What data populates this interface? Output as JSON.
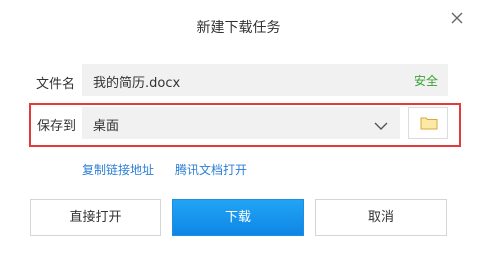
{
  "dialog": {
    "title": "新建下载任务"
  },
  "filename": {
    "label": "文件名",
    "value": "我的简历.docx",
    "safety_badge": "安全",
    "safety_color": "#3aa037"
  },
  "save_location": {
    "label": "保存到",
    "selected": "桌面",
    "highlight_color": "#e23b3b"
  },
  "links": {
    "copy_link": "复制链接地址",
    "open_tencent_docs": "腾讯文档打开",
    "color": "#2b7fd6"
  },
  "buttons": {
    "open_directly": "直接打开",
    "download": "下载",
    "cancel": "取消",
    "accent_color": "#1a96ee"
  },
  "icons": {
    "close": "close-icon",
    "dropdown": "chevron-down-icon",
    "folder": "folder-icon"
  }
}
